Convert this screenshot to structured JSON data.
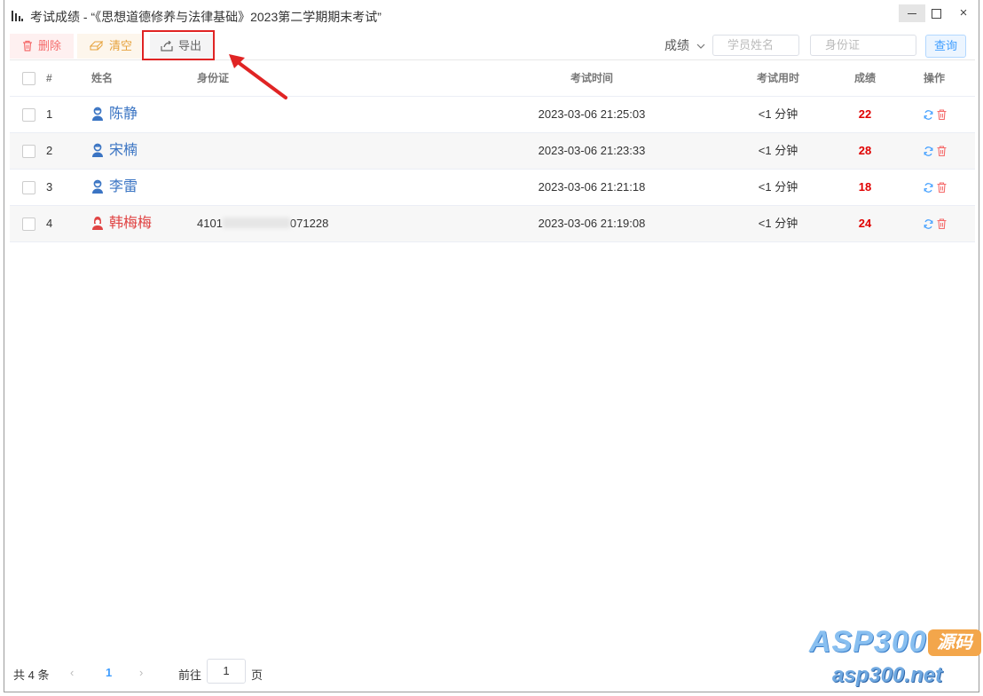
{
  "window": {
    "title": "考试成绩 - “《思想道德修养与法律基础》2023第二学期期末考试”",
    "close_glyph": "×"
  },
  "toolbar": {
    "delete_label": "删除",
    "clear_label": "清空",
    "export_label": "导出",
    "sort_label": "成绩",
    "name_placeholder": "学员姓名",
    "id_placeholder": "身份证",
    "query_label": "查询"
  },
  "table": {
    "headers": {
      "index": "#",
      "name": "姓名",
      "id": "身份证",
      "time": "考试时间",
      "duration": "考试用时",
      "score": "成绩",
      "ops": "操作"
    },
    "rows": [
      {
        "index": "1",
        "name": "陈静",
        "id_prefix": "",
        "id_suffix": "",
        "time": "2023-03-06 21:25:03",
        "duration": "<1 分钟",
        "score": "22",
        "gender": "male"
      },
      {
        "index": "2",
        "name": "宋楠",
        "id_prefix": "",
        "id_suffix": "",
        "time": "2023-03-06 21:23:33",
        "duration": "<1 分钟",
        "score": "28",
        "gender": "male"
      },
      {
        "index": "3",
        "name": "李雷",
        "id_prefix": "",
        "id_suffix": "",
        "time": "2023-03-06 21:21:18",
        "duration": "<1 分钟",
        "score": "18",
        "gender": "male"
      },
      {
        "index": "4",
        "name": "韩梅梅",
        "id_prefix": "4101",
        "id_suffix": "071228",
        "time": "2023-03-06 21:19:08",
        "duration": "<1 分钟",
        "score": "24",
        "gender": "female"
      }
    ]
  },
  "pagination": {
    "total_text": "共 4 条",
    "prev_glyph": "‹",
    "current_page": "1",
    "next_glyph": "›",
    "goto_label": "前往",
    "goto_value": "1",
    "page_unit": "页"
  },
  "watermark": {
    "brand": "ASP300",
    "tag": "源码",
    "url": "asp300.net"
  },
  "colors": {
    "accent": "#409eff",
    "score": "#e00000",
    "male_name": "#3a74c3",
    "female_name": "#e04444",
    "highlight": "#e02424"
  }
}
